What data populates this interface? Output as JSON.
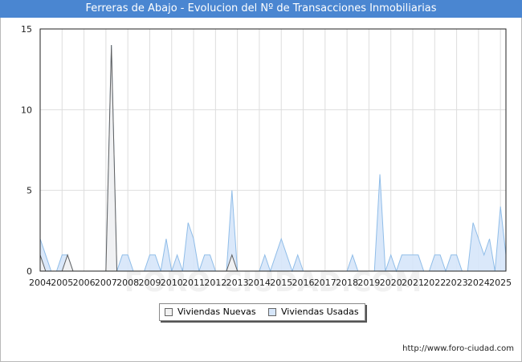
{
  "title": "Ferreras de Abajo - Evolucion del Nº de Transacciones Inmobiliarias",
  "source_url": "http://www.foro-ciudad.com",
  "watermark": "FORO-CIUDAD.COM",
  "colors": {
    "title_bg": "#4a86d1",
    "nuevas_fill": "#f2f2f2",
    "nuevas_line": "#606060",
    "usadas_fill": "#d6e6fa",
    "usadas_line": "#90bde8"
  },
  "legend": {
    "nuevas": "Viviendas Nuevas",
    "usadas": "Viviendas Usadas"
  },
  "chart_data": {
    "type": "area",
    "title": "Ferreras de Abajo - Evolucion del Nº de Transacciones Inmobiliarias",
    "x_unit": "quarter",
    "x_start": "2004 Q1",
    "categories": [
      "2004",
      "2005",
      "2006",
      "2007",
      "2008",
      "2009",
      "2010",
      "2011",
      "2012",
      "2013",
      "2014",
      "2015",
      "2016",
      "2017",
      "2018",
      "2019",
      "2020",
      "2021",
      "2022",
      "2023",
      "2024",
      "2025"
    ],
    "ylim": [
      0,
      15
    ],
    "yticks": [
      0,
      5,
      10,
      15
    ],
    "grid": true,
    "legend_position": "bottom",
    "series": [
      {
        "name": "Viviendas Usadas",
        "values": [
          2,
          1,
          0,
          0,
          1,
          1,
          0,
          0,
          0,
          0,
          0,
          0,
          0,
          14,
          0,
          1,
          1,
          0,
          0,
          0,
          1,
          1,
          0,
          2,
          0,
          1,
          0,
          3,
          2,
          0,
          1,
          1,
          0,
          0,
          0,
          5,
          0,
          0,
          0,
          0,
          0,
          1,
          0,
          1,
          2,
          1,
          0,
          1,
          0,
          0,
          0,
          0,
          0,
          0,
          0,
          0,
          0,
          1,
          0,
          0,
          0,
          0,
          6,
          0,
          1,
          0,
          1,
          1,
          1,
          1,
          0,
          0,
          1,
          1,
          0,
          1,
          1,
          0,
          0,
          3,
          2,
          1,
          2,
          0,
          4,
          1
        ]
      },
      {
        "name": "Viviendas Nuevas",
        "values": [
          1,
          0,
          0,
          0,
          0,
          1,
          0,
          0,
          0,
          0,
          0,
          0,
          0,
          14,
          0,
          0,
          0,
          0,
          0,
          0,
          0,
          0,
          0,
          0,
          0,
          0,
          0,
          0,
          0,
          0,
          0,
          0,
          0,
          0,
          0,
          1,
          0,
          0,
          0,
          0,
          0,
          0,
          0,
          0,
          0,
          0,
          0,
          0,
          0,
          0,
          0,
          0,
          0,
          0,
          0,
          0,
          0,
          0,
          0,
          0,
          0,
          0,
          0,
          0,
          0,
          0,
          0,
          0,
          0,
          0,
          0,
          0,
          0,
          0,
          0,
          0,
          0,
          0,
          0,
          0,
          0,
          0,
          0,
          0,
          0,
          0
        ]
      }
    ]
  }
}
